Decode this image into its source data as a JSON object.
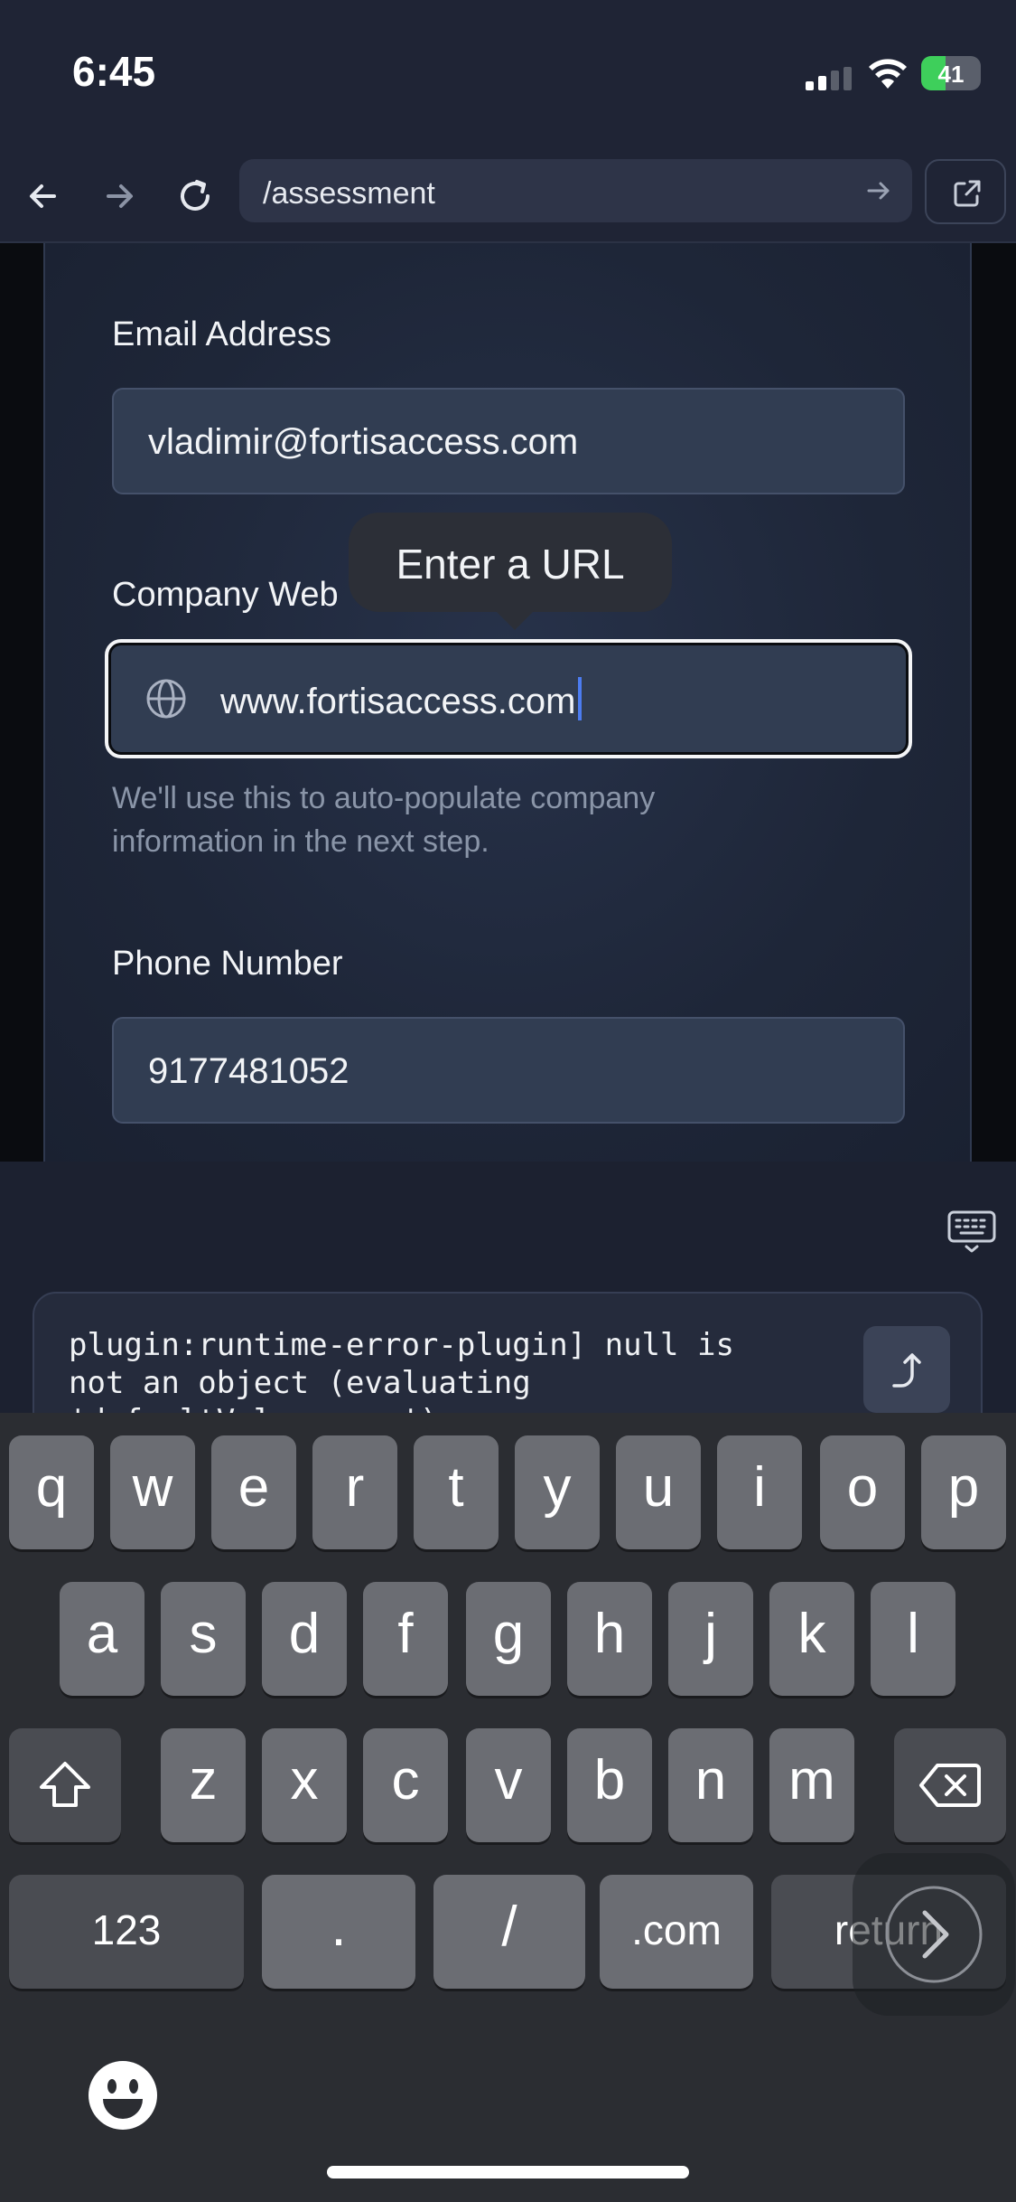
{
  "status_bar": {
    "time": "6:45",
    "battery_level": "41",
    "battery_fraction": 0.41
  },
  "browser": {
    "url": "/assessment"
  },
  "form": {
    "email": {
      "label": "Email Address",
      "value": "vladimir@fortisaccess.com"
    },
    "website": {
      "label": "Company Web",
      "value": "www.fortisaccess.com",
      "help": "We'll use this to auto-populate company information in the next step."
    },
    "tooltip": "Enter a URL",
    "phone": {
      "label": "Phone Number",
      "value": "9177481052"
    }
  },
  "console": {
    "message": "plugin:runtime-error-plugin] null is\nnot an object (evaluating\n'defaultValue.name')"
  },
  "keyboard": {
    "row1": [
      "q",
      "w",
      "e",
      "r",
      "t",
      "y",
      "u",
      "i",
      "o",
      "p"
    ],
    "row2": [
      "a",
      "s",
      "d",
      "f",
      "g",
      "h",
      "j",
      "k",
      "l"
    ],
    "row3": [
      "z",
      "x",
      "c",
      "v",
      "b",
      "n",
      "m"
    ],
    "numbers_key": "123",
    "dot_key": ".",
    "slash_key": "/",
    "dotcom_key": ".com",
    "return_key": "return"
  },
  "colors": {
    "accent_caret": "#4c7cf0",
    "battery_green": "#3ecf5b"
  }
}
